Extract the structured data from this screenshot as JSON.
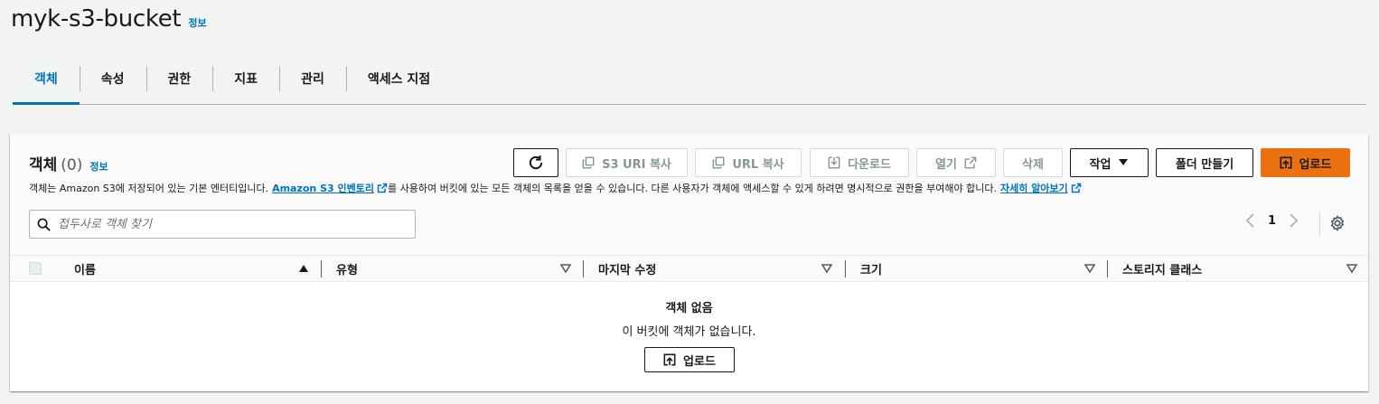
{
  "header": {
    "title": "myk-s3-bucket",
    "info": "정보"
  },
  "tabs": [
    {
      "label": "객체",
      "active": true
    },
    {
      "label": "속성"
    },
    {
      "label": "권한"
    },
    {
      "label": "지표"
    },
    {
      "label": "관리"
    },
    {
      "label": "액세스 지점"
    }
  ],
  "objects": {
    "title": "객체",
    "count": "(0)",
    "info": "정보",
    "description": {
      "part1": "객체는 Amazon S3에 저장되어 있는 기본 엔터티입니다.",
      "link1": "Amazon S3 인벤토리",
      "part2": "를 사용하여 버킷에 있는 모든 객체의 목록을 얻을 수 있습니다. 다른 사용자가 객체에 액세스할 수 있게 하려면 명시적으로 권한을 부여해야 합니다.",
      "link2": "자세히 알아보기"
    }
  },
  "toolbar": {
    "refresh_icon": "refresh-icon",
    "copy_s3_uri": "S3 URI 복사",
    "copy_url": "URL 복사",
    "download": "다운로드",
    "open": "열기",
    "delete": "삭제",
    "actions": "작업",
    "create_folder": "폴더 만들기",
    "upload": "업로드"
  },
  "search": {
    "placeholder": "접두사로 객체 찾기"
  },
  "pagination": {
    "page": "1"
  },
  "table": {
    "columns": [
      "이름",
      "유형",
      "마지막 수정",
      "크기",
      "스토리지 클래스"
    ]
  },
  "empty": {
    "title": "객체 없음",
    "message": "이 버킷에 객체가 없습니다.",
    "upload": "업로드"
  },
  "colors": {
    "accent": "#0073bb",
    "primary": "#ec7211",
    "disabled": "#879596"
  }
}
